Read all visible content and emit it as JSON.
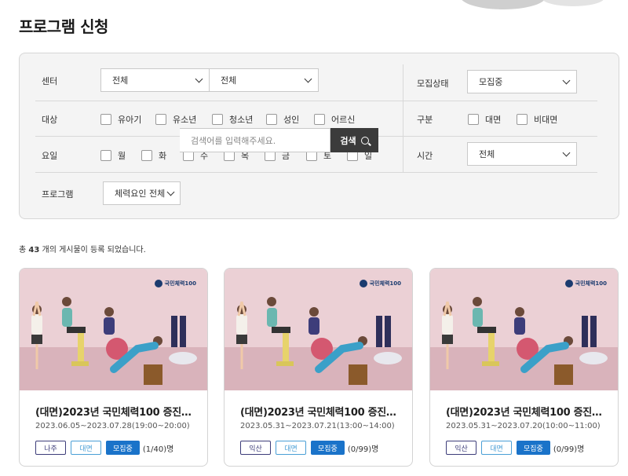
{
  "page_title": "프로그램 신청",
  "filters": {
    "center_label": "센터",
    "center_select1": "전체",
    "center_select2": "전체",
    "recruit_label": "모집상태",
    "recruit_value": "모집중",
    "target_label": "대상",
    "targets": [
      "유아기",
      "유소년",
      "청소년",
      "성인",
      "어르신"
    ],
    "category_label": "구분",
    "categories": [
      "대면",
      "비대면"
    ],
    "day_label": "요일",
    "days": [
      "월",
      "화",
      "수",
      "목",
      "금",
      "토",
      "일"
    ],
    "time_label": "시간",
    "time_value": "전체",
    "program_label": "프로그램",
    "program_select": "체력요인 전체",
    "search_placeholder": "검색어를 입력해주세요.",
    "search_button": "검색"
  },
  "count": {
    "prefix": "총 ",
    "number": "43",
    "suffix": " 개의 게시물이 등록 되었습니다."
  },
  "cards": [
    {
      "brand": "국민체력100",
      "title": "(대면)2023년 국민체력100 증진…",
      "date": "2023.06.05~2023.07.28(19:00~20:00)",
      "site": "나주",
      "type": "대면",
      "status": "모집중",
      "capacity": "(1/40)명"
    },
    {
      "brand": "국민체력100",
      "title": "(대면)2023년 국민체력100 증진…",
      "date": "2023.05.31~2023.07.21(13:00~14:00)",
      "site": "익산",
      "type": "대면",
      "status": "모집중",
      "capacity": "(0/99)명"
    },
    {
      "brand": "국민체력100",
      "title": "(대면)2023년 국민체력100 증진…",
      "date": "2023.05.31~2023.07.20(10:00~11:00)",
      "site": "익산",
      "type": "대면",
      "status": "모집중",
      "capacity": "(0/99)명"
    }
  ],
  "colors": {
    "accent": "#1a73c9",
    "search_button": "#3b3b3b",
    "card_image_bg": "#ebd0d5"
  }
}
